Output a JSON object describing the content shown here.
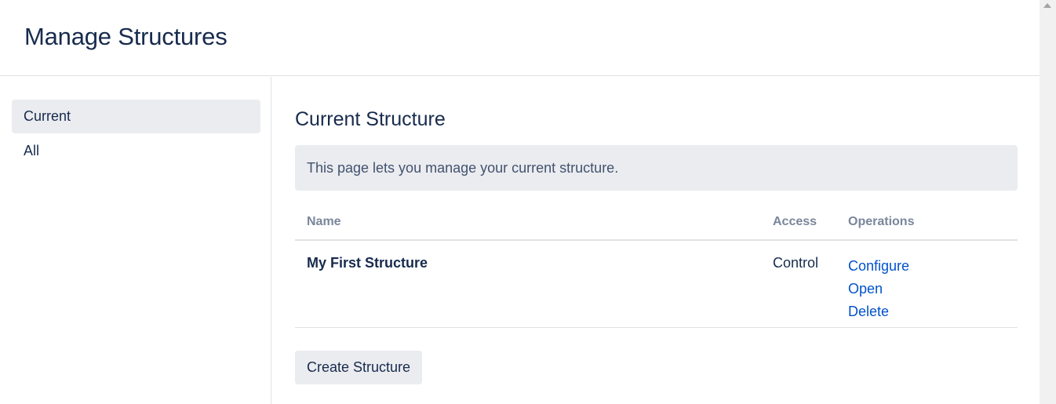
{
  "header": {
    "title": "Manage Structures"
  },
  "sidebar": {
    "items": [
      {
        "label": "Current",
        "active": true
      },
      {
        "label": "All",
        "active": false
      }
    ]
  },
  "main": {
    "section_title": "Current Structure",
    "info_message": "This page lets you manage your current structure.",
    "table": {
      "columns": [
        "Name",
        "Access",
        "Operations"
      ],
      "rows": [
        {
          "name": "My First Structure",
          "access": "Control",
          "operations": [
            "Configure",
            "Open",
            "Delete"
          ]
        }
      ]
    },
    "create_button_label": "Create Structure"
  },
  "colors": {
    "link": "#0052cc",
    "text": "#172b4d",
    "muted_header": "#7a869a",
    "panel_bg": "#ebecf0",
    "border": "#dfe1e6"
  },
  "icons": {
    "scroll_up": "scroll-up-arrow-icon"
  }
}
